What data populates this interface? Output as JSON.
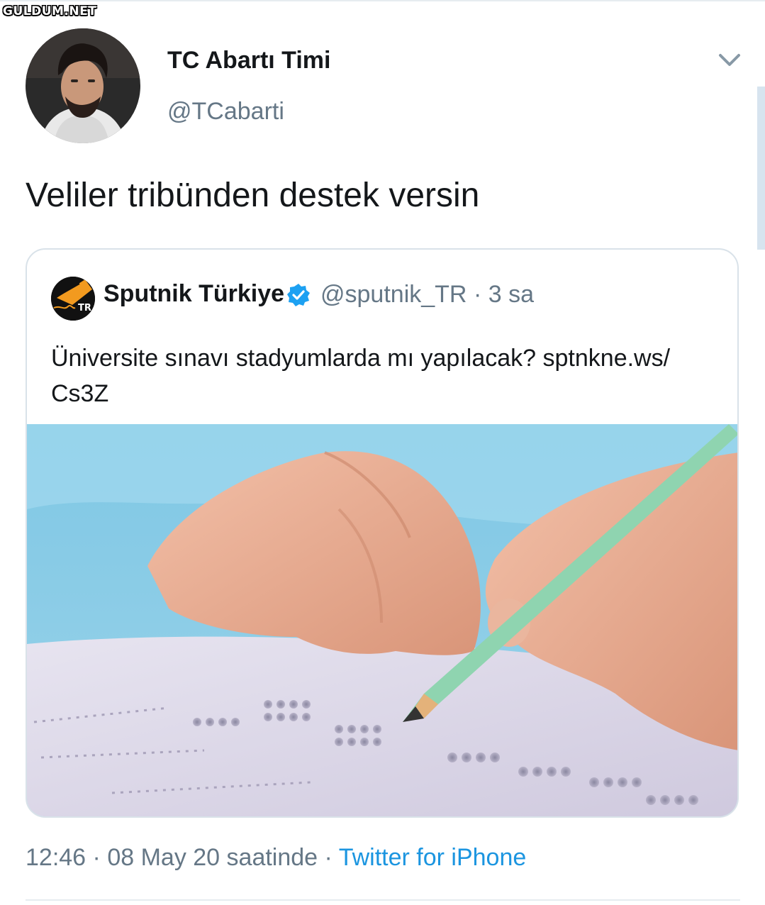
{
  "watermark": "GULDUM.NET",
  "tweet": {
    "display_name": "TC Abartı Timi",
    "handle": "@TCabarti",
    "text": "Veliler tribünden destek versin",
    "time": "12:46",
    "date": "08 May 20 saatinde",
    "separator": "·",
    "client": "Twitter for iPhone"
  },
  "quoted": {
    "display_name": "Sputnik Türkiye",
    "handle": "@sputnik_TR",
    "age": "3 sa",
    "text": "Üniversite sınavı stadyumlarda mı yapılacak? sptnkne.ws/ Cs3Z",
    "avatar_label": "TR"
  },
  "icons": {
    "menu": "chevron-down-icon",
    "verified": "verified-badge-icon"
  },
  "colors": {
    "link": "#1b95e0",
    "secondary_text": "#657786",
    "border": "#d9e2e9"
  }
}
